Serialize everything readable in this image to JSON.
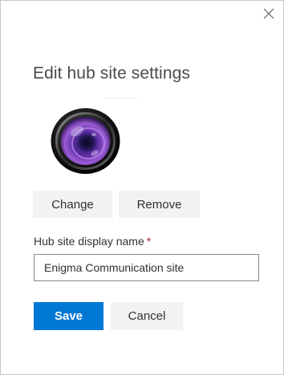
{
  "dialog": {
    "title": "Edit hub site settings",
    "close_icon": "close-icon"
  },
  "logo": {
    "icon": "camera-lens-icon"
  },
  "logo_actions": {
    "change_label": "Change",
    "remove_label": "Remove"
  },
  "display_name": {
    "label": "Hub site display name",
    "required_mark": "*",
    "value": "Enigma Communication site"
  },
  "footer": {
    "save_label": "Save",
    "cancel_label": "Cancel"
  },
  "colors": {
    "primary": "#0078d4",
    "required": "#a4262c",
    "secondary_button": "#f3f2f1"
  }
}
